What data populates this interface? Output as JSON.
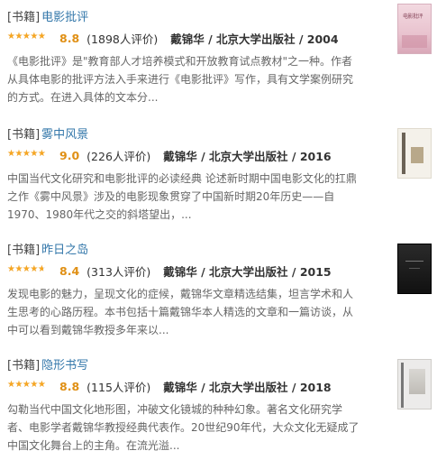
{
  "items": [
    {
      "tag": "[书籍]",
      "title": "电影批评",
      "score": "8.8",
      "count": "(1898人评价)",
      "meta": "戴锦华 / 北京大学出版社 / 2004",
      "desc": "《电影批评》是\"教育部人才培养模式和开放教育试点教材\"之一种。作者从具体电影的批评方法入手来进行《电影批评》写作，具有文学案例研究的方式。在进入具体的文本分...",
      "rating_fraction": 0.88,
      "cover_text": "电影批评"
    },
    {
      "tag": "[书籍]",
      "title": "雾中风景",
      "score": "9.0",
      "count": "(226人评价)",
      "meta": "戴锦华 / 北京大学出版社 / 2016",
      "desc": "中国当代文化研究和电影批评的必读经典 论述新时期中国电影文化的扛鼎之作《雾中风景》涉及的电影现象贯穿了中国新时期20年历史——自1970、1980年代之交的斜塔望出，...",
      "rating_fraction": 0.9
    },
    {
      "tag": "[书籍]",
      "title": "昨日之岛",
      "score": "8.4",
      "count": "(313人评价)",
      "meta": "戴锦华 / 北京大学出版社 / 2015",
      "desc": "发现电影的魅力，呈现文化的症候，戴锦华文章精选结集，坦言学术和人生思考的心路历程。本书包括十篇戴锦华本人精选的文章和一篇访谈，从中可以看到戴锦华教授多年来以...",
      "rating_fraction": 0.84
    },
    {
      "tag": "[书籍]",
      "title": "隐形书写",
      "score": "8.8",
      "count": "(115人评价)",
      "meta": "戴锦华 / 北京大学出版社 / 2018",
      "desc": "勾勒当代中国文化地形图，冲破文化镜城的种种幻象。著名文化研究学者、电影学者戴锦华教授经典代表作。20世纪90年代，大众文化无疑成了中国文化舞台上的主角。在流光溢...",
      "rating_fraction": 0.88
    }
  ],
  "colors": {
    "title_link": "#3377aa",
    "score": "#e09015",
    "star": "#f6a623",
    "desc": "#666666"
  }
}
